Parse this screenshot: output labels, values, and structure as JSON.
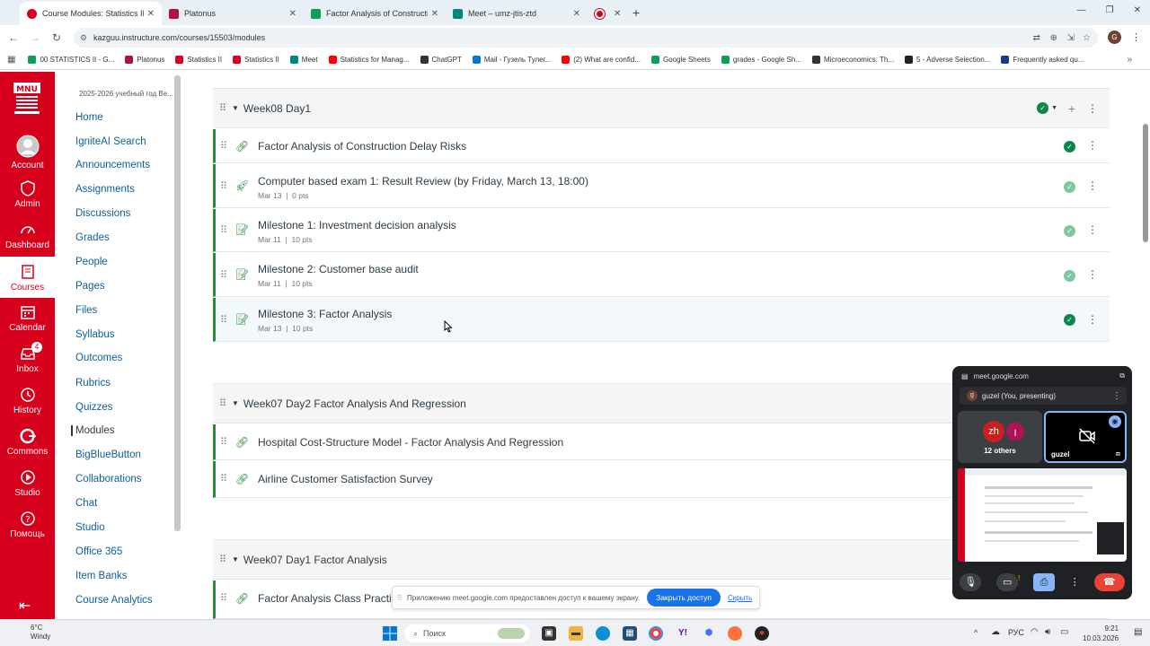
{
  "browser": {
    "tabs": [
      {
        "title": "Course Modules: Statistics II",
        "color": "#d6001c",
        "active": true
      },
      {
        "title": "Platonus",
        "color": "#b0123f",
        "active": false
      },
      {
        "title": "Factor Analysis of Construction",
        "color": "#0f9d58",
        "active": false
      },
      {
        "title": "Meet – umz-jtis-ztd",
        "color": "#00897b",
        "active": false
      },
      {
        "title": "",
        "color": "#d6001c",
        "active": false
      }
    ],
    "url": "kazguu.instructure.com/courses/15503/modules",
    "profile_initial": "G",
    "bookmarks": [
      {
        "label": "00 STATISTICS II - G...",
        "color": "#0f9d58"
      },
      {
        "label": "Platonus",
        "color": "#b0123f"
      },
      {
        "label": "Statistics II",
        "color": "#d6001c"
      },
      {
        "label": "Statistics II",
        "color": "#d6001c"
      },
      {
        "label": "Meet",
        "color": "#00897b"
      },
      {
        "label": "Statistics for Manag...",
        "color": "#ff0000"
      },
      {
        "label": "ChatGPT",
        "color": "#333333"
      },
      {
        "label": "Mail - Гузель Тулег...",
        "color": "#0078d4"
      },
      {
        "label": "(2) What are confid...",
        "color": "#ff0000"
      },
      {
        "label": "Google Sheets",
        "color": "#0f9d58"
      },
      {
        "label": "grades - Google Sh...",
        "color": "#0f9d58"
      },
      {
        "label": "Microeconomics: Th...",
        "color": "#333333"
      },
      {
        "label": "5 - Adverse Selection...",
        "color": "#222222"
      },
      {
        "label": "Frequently asked qu...",
        "color": "#1a3a8a"
      }
    ]
  },
  "global_nav": {
    "logo_text": "MNU",
    "items": [
      {
        "label": "Account"
      },
      {
        "label": "Admin"
      },
      {
        "label": "Dashboard"
      },
      {
        "label": "Courses"
      },
      {
        "label": "Calendar"
      },
      {
        "label": "Inbox",
        "badge": "4"
      },
      {
        "label": "History"
      },
      {
        "label": "Commons"
      },
      {
        "label": "Studio"
      },
      {
        "label": "Помощь"
      }
    ]
  },
  "course_nav": {
    "term": "2025-2026 учебный год Ве...",
    "items": [
      {
        "label": "Home"
      },
      {
        "label": "IgniteAI Search"
      },
      {
        "label": "Announcements"
      },
      {
        "label": "Assignments"
      },
      {
        "label": "Discussions",
        "hidden": true
      },
      {
        "label": "Grades"
      },
      {
        "label": "People"
      },
      {
        "label": "Pages"
      },
      {
        "label": "Files"
      },
      {
        "label": "Syllabus"
      },
      {
        "label": "Outcomes",
        "hidden": true
      },
      {
        "label": "Rubrics"
      },
      {
        "label": "Quizzes"
      },
      {
        "label": "Modules",
        "active": true
      },
      {
        "label": "BigBlueButton"
      },
      {
        "label": "Collaborations"
      },
      {
        "label": "Chat"
      },
      {
        "label": "Studio"
      },
      {
        "label": "Office 365"
      },
      {
        "label": "Item Banks"
      },
      {
        "label": "Course Analytics"
      }
    ]
  },
  "modules": [
    {
      "title": "Week08 Day1",
      "items": [
        {
          "title": "Factor Analysis of Construction Delay Risks",
          "type": "link",
          "date": "",
          "points": "",
          "status": "complete"
        },
        {
          "title": "Computer based exam 1: Result Review (by Friday, March 13, 18:00)",
          "type": "quiz",
          "date": "Mar 13",
          "points": "0 pts",
          "status": "partial"
        },
        {
          "title": "Milestone 1: Investment decision analysis",
          "type": "assignment",
          "date": "Mar 11",
          "points": "10 pts",
          "status": "partial"
        },
        {
          "title": "Milestone 2: Customer base audit",
          "type": "assignment",
          "date": "Mar 11",
          "points": "10 pts",
          "status": "partial"
        },
        {
          "title": "Milestone 3: Factor Analysis",
          "type": "assignment",
          "date": "Mar 13",
          "points": "10 pts",
          "status": "complete"
        }
      ]
    },
    {
      "title": "Week07 Day2 Factor Analysis And Regression",
      "items": [
        {
          "title": "Hospital Cost-Structure Model - Factor Analysis And Regression",
          "type": "link"
        },
        {
          "title": "Airline Customer Satisfaction Survey",
          "type": "link"
        }
      ]
    },
    {
      "title": "Week07 Day1 Factor Analysis",
      "items": [
        {
          "title": "Factor Analysis Class Practic",
          "type": "link"
        }
      ]
    }
  ],
  "meet": {
    "domain": "meet.google.com",
    "presenter": "guzel (You, presenting)",
    "presenter_initial": "g",
    "others_count": "12 others",
    "avatar1": "zh",
    "avatar2": "I",
    "self_name": "guzel"
  },
  "share_bar": {
    "message": "Приложению meet.google.com предоставлен доступ к вашему экрану.",
    "stop_button": "Закрыть доступ",
    "hide_link": "Скрыть"
  },
  "taskbar": {
    "weather_temp": "6°C",
    "weather_desc": "Windy",
    "search_placeholder": "Поиск",
    "language": "РУС",
    "time": "9:21",
    "date": "10.03.2026"
  },
  "colors": {
    "canvas_red": "#d6001c",
    "success": "#0b874b",
    "link": "#0b5f9a"
  }
}
